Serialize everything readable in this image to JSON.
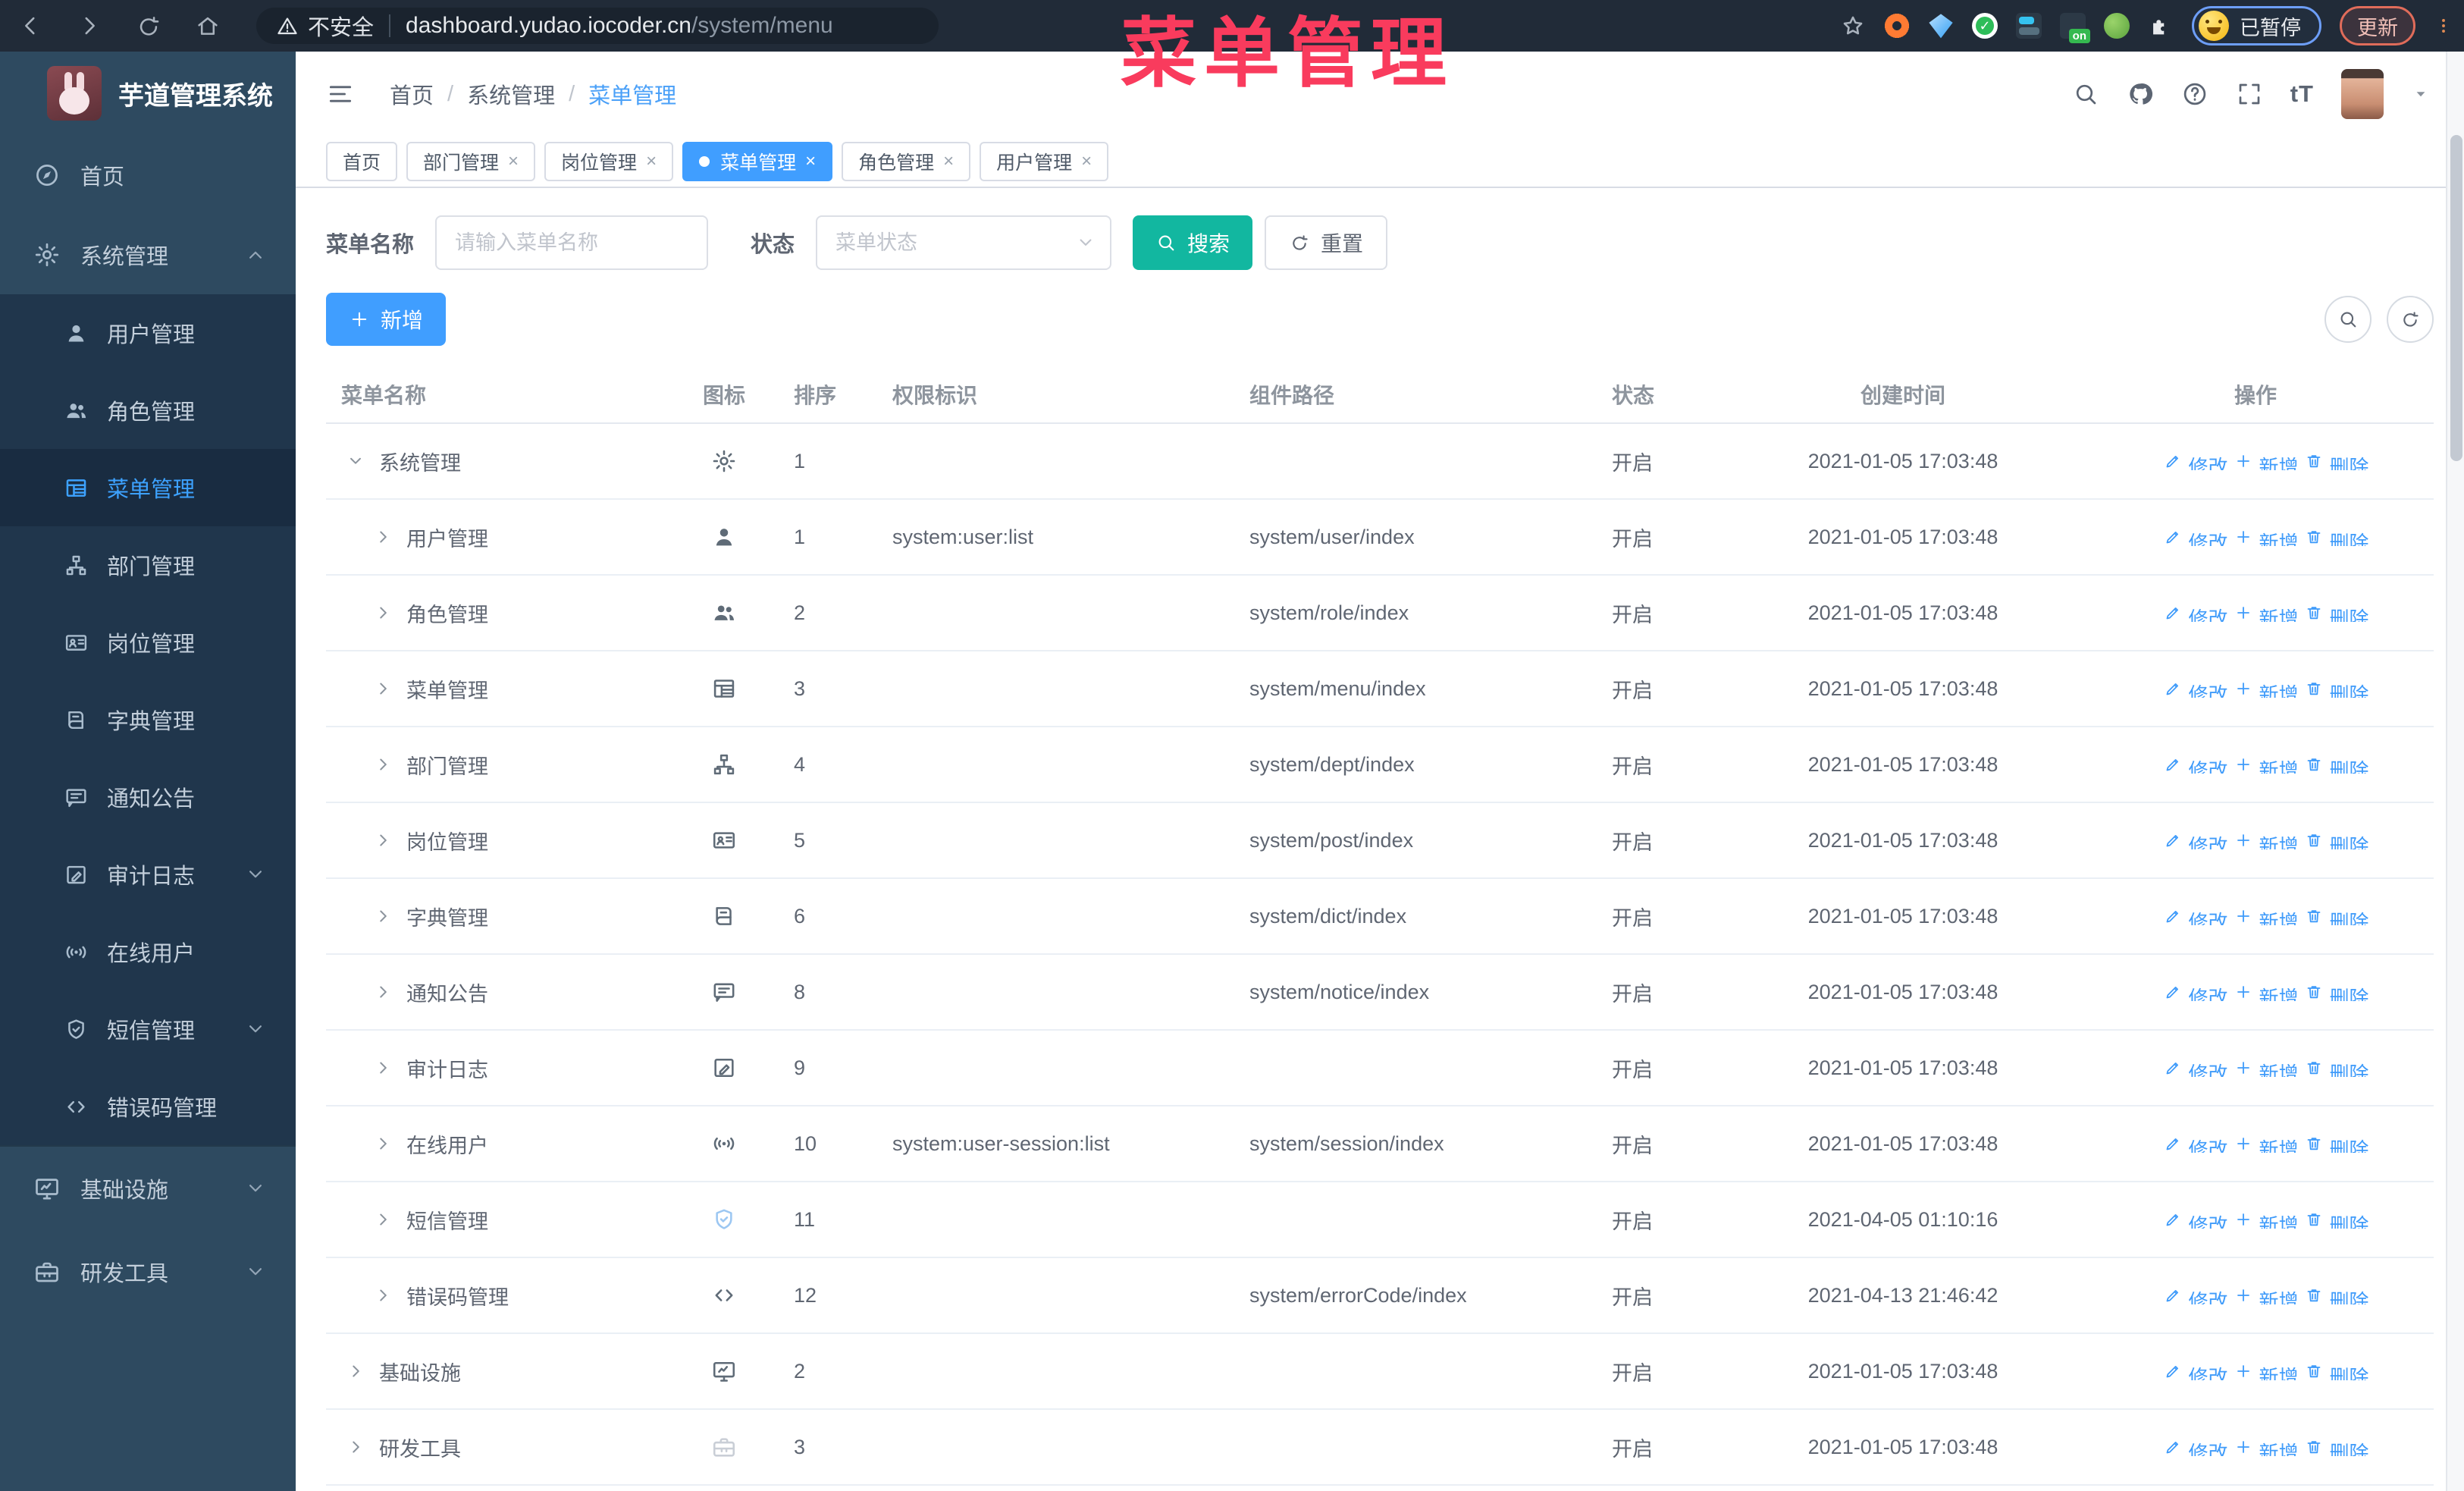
{
  "browser": {
    "security_label": "不安全",
    "url_host": "dashboard.yudao.iocoder.cn",
    "url_path": "/system/menu",
    "ext_on_label": "on",
    "profile_label": "已暂停",
    "update_label": "更新"
  },
  "overlay_title": "菜单管理",
  "sidebar": {
    "logo_title": "芋道管理系统",
    "items": [
      {
        "label": "首页",
        "icon": "compass",
        "type": "top"
      },
      {
        "label": "系统管理",
        "icon": "gear",
        "type": "top",
        "arrow": "up"
      },
      {
        "label": "用户管理",
        "icon": "user",
        "type": "sub"
      },
      {
        "label": "角色管理",
        "icon": "users",
        "type": "sub"
      },
      {
        "label": "菜单管理",
        "icon": "table",
        "type": "sub",
        "active": true
      },
      {
        "label": "部门管理",
        "icon": "tree",
        "type": "sub"
      },
      {
        "label": "岗位管理",
        "icon": "idcard",
        "type": "sub"
      },
      {
        "label": "字典管理",
        "icon": "book",
        "type": "sub"
      },
      {
        "label": "通知公告",
        "icon": "message",
        "type": "sub"
      },
      {
        "label": "审计日志",
        "icon": "edit",
        "type": "sub",
        "arrow": "down"
      },
      {
        "label": "在线用户",
        "icon": "online",
        "type": "sub"
      },
      {
        "label": "短信管理",
        "icon": "shield",
        "type": "sub",
        "arrow": "down"
      },
      {
        "label": "错误码管理",
        "icon": "code",
        "type": "sub"
      },
      {
        "label": "基础设施",
        "icon": "monitor",
        "type": "top2",
        "arrow": "down"
      },
      {
        "label": "研发工具",
        "icon": "toolbox",
        "type": "top2",
        "arrow": "down"
      }
    ]
  },
  "header": {
    "breadcrumb": [
      "首页",
      "系统管理",
      "菜单管理"
    ],
    "separator": "/",
    "font_icon_label": "tT"
  },
  "tabs": [
    {
      "label": "首页",
      "closable": false,
      "active": false
    },
    {
      "label": "部门管理",
      "closable": true,
      "active": false
    },
    {
      "label": "岗位管理",
      "closable": true,
      "active": false
    },
    {
      "label": "菜单管理",
      "closable": true,
      "active": true
    },
    {
      "label": "角色管理",
      "closable": true,
      "active": false
    },
    {
      "label": "用户管理",
      "closable": true,
      "active": false
    }
  ],
  "filter": {
    "name_label": "菜单名称",
    "name_placeholder": "请输入菜单名称",
    "status_label": "状态",
    "status_placeholder": "菜单状态",
    "search_label": "搜索",
    "reset_label": "重置"
  },
  "toolbar": {
    "add_label": "新增"
  },
  "table": {
    "columns": [
      "菜单名称",
      "图标",
      "排序",
      "权限标识",
      "组件路径",
      "状态",
      "创建时间",
      "操作"
    ],
    "action_labels": [
      "修改",
      "新增",
      "删除"
    ],
    "rows": [
      {
        "name": "系统管理",
        "icon": "gear",
        "level": 0,
        "expanded": true,
        "sort": "1",
        "perm": "",
        "path": "",
        "status": "开启",
        "created": "2021-01-05 17:03:48"
      },
      {
        "name": "用户管理",
        "icon": "user",
        "level": 1,
        "sort": "1",
        "perm": "system:user:list",
        "path": "system/user/index",
        "status": "开启",
        "created": "2021-01-05 17:03:48"
      },
      {
        "name": "角色管理",
        "icon": "users",
        "level": 1,
        "sort": "2",
        "perm": "",
        "path": "system/role/index",
        "status": "开启",
        "created": "2021-01-05 17:03:48"
      },
      {
        "name": "菜单管理",
        "icon": "table",
        "level": 1,
        "sort": "3",
        "perm": "",
        "path": "system/menu/index",
        "status": "开启",
        "created": "2021-01-05 17:03:48"
      },
      {
        "name": "部门管理",
        "icon": "tree",
        "level": 1,
        "sort": "4",
        "perm": "",
        "path": "system/dept/index",
        "status": "开启",
        "created": "2021-01-05 17:03:48"
      },
      {
        "name": "岗位管理",
        "icon": "idcard",
        "level": 1,
        "sort": "5",
        "perm": "",
        "path": "system/post/index",
        "status": "开启",
        "created": "2021-01-05 17:03:48"
      },
      {
        "name": "字典管理",
        "icon": "book",
        "level": 1,
        "sort": "6",
        "perm": "",
        "path": "system/dict/index",
        "status": "开启",
        "created": "2021-01-05 17:03:48"
      },
      {
        "name": "通知公告",
        "icon": "message",
        "level": 1,
        "sort": "8",
        "perm": "",
        "path": "system/notice/index",
        "status": "开启",
        "created": "2021-01-05 17:03:48"
      },
      {
        "name": "审计日志",
        "icon": "edit",
        "level": 1,
        "sort": "9",
        "perm": "",
        "path": "",
        "status": "开启",
        "created": "2021-01-05 17:03:48"
      },
      {
        "name": "在线用户",
        "icon": "online",
        "level": 1,
        "sort": "10",
        "perm": "system:user-session:list",
        "path": "system/session/index",
        "status": "开启",
        "created": "2021-01-05 17:03:48"
      },
      {
        "name": "短信管理",
        "icon": "shield",
        "level": 1,
        "sort": "11",
        "perm": "",
        "path": "",
        "status": "开启",
        "created": "2021-04-05 01:10:16",
        "icon_color": "#9cc7f2"
      },
      {
        "name": "错误码管理",
        "icon": "code",
        "level": 1,
        "sort": "12",
        "perm": "",
        "path": "system/errorCode/index",
        "status": "开启",
        "created": "2021-04-13 21:46:42"
      },
      {
        "name": "基础设施",
        "icon": "monitor",
        "level": 0,
        "sort": "2",
        "perm": "",
        "path": "",
        "status": "开启",
        "created": "2021-01-05 17:03:48"
      },
      {
        "name": "研发工具",
        "icon": "toolbox",
        "level": 0,
        "sort": "3",
        "perm": "",
        "path": "",
        "status": "开启",
        "created": "2021-01-05 17:03:48",
        "icon_color": "#c9ced6"
      }
    ]
  },
  "colors": {
    "accent": "#409eff",
    "search_button": "#12b7a0",
    "overlay_red": "#f93b5d",
    "link": "#3f9bfa",
    "sidebar_bg": "#2e4a60",
    "submenu_bg": "#20364c"
  }
}
